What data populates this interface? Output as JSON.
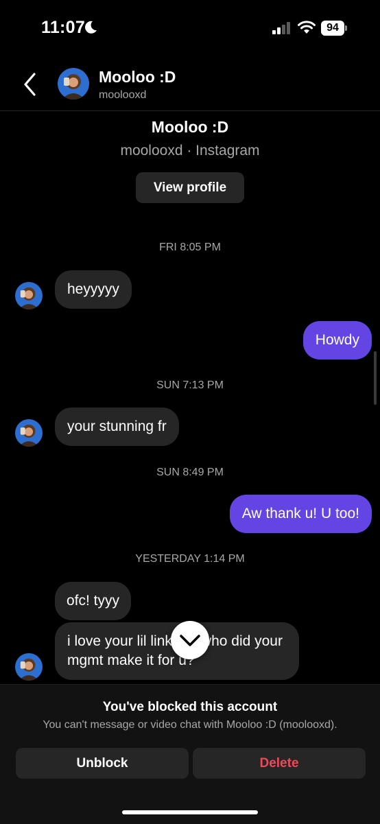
{
  "status_bar": {
    "time": "11:07",
    "battery": "94"
  },
  "header": {
    "name": "Mooloo :D",
    "username": "moolooxd"
  },
  "intro": {
    "name": "Mooloo :D",
    "subtitle": "moolooxd · Instagram",
    "view_profile_label": "View profile"
  },
  "messages": {
    "stamp1": "FRI 8:05 PM",
    "m1": "heyyyyy",
    "m2": "Howdy",
    "stamp2": "SUN 7:13 PM",
    "m3": "your stunning fr",
    "stamp3": "SUN 8:49 PM",
    "m4": "Aw thank u! U too!",
    "stamp4": "YESTERDAY 1:14 PM",
    "m5": "ofc! tyyy",
    "m6": "i love your lil linktree who did your mgmt make it for u?"
  },
  "blocked": {
    "title": "You've blocked this account",
    "description": "You can't message or video chat with Mooloo :D (moolooxd).",
    "unblock_label": "Unblock",
    "delete_label": "Delete"
  },
  "colors": {
    "outgoing_bubble": "#6544e4",
    "incoming_bubble": "#262626",
    "delete": "#ed4956"
  },
  "icons": [
    "moon-icon",
    "cellular-signal-icon",
    "wifi-icon",
    "battery-icon",
    "back-chevron-icon",
    "chevron-down-icon"
  ]
}
